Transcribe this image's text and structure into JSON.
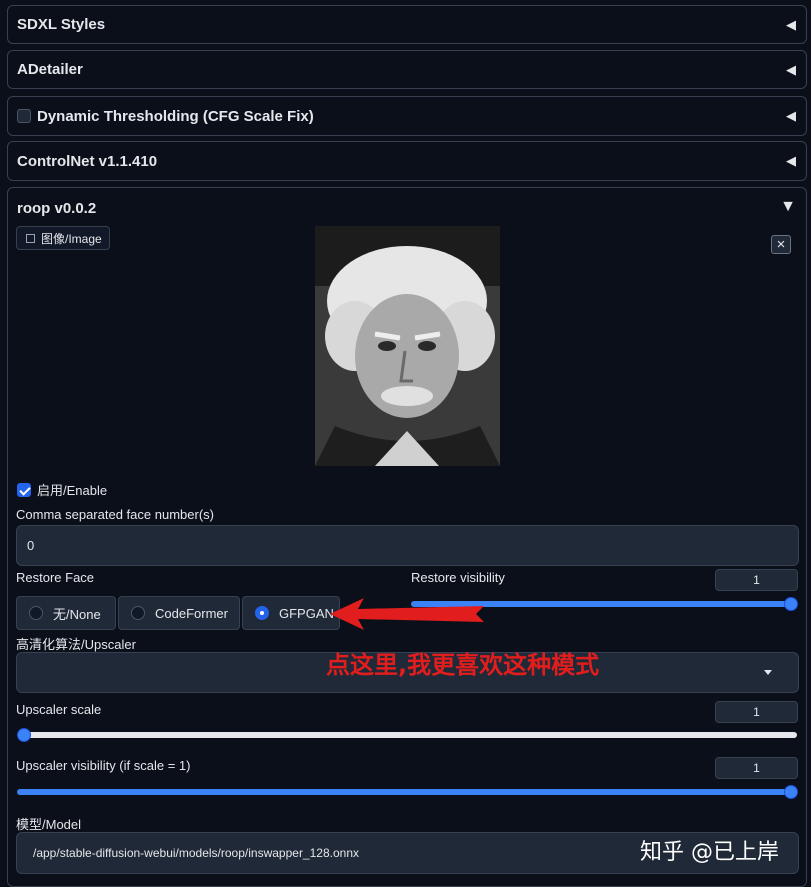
{
  "accordions": {
    "sdxl_styles": "SDXL Styles",
    "adetailer": "ADetailer",
    "dynamic_thresholding": "Dynamic Thresholding (CFG Scale Fix)",
    "controlnet": "ControlNet v1.1.410",
    "roop": "roop v0.0.2"
  },
  "collapsed_icon": "◀",
  "expanded_icon": "▼",
  "image_tab": {
    "icon": "image-icon",
    "label": "图像/Image"
  },
  "close_symbol": "×",
  "enable": {
    "label": "启用/Enable",
    "checked": true
  },
  "face_numbers": {
    "label": "Comma separated face number(s)",
    "value": "0"
  },
  "restore_face": {
    "label": "Restore Face",
    "options": [
      "无/None",
      "CodeFormer",
      "GFPGAN"
    ],
    "selected": "GFPGAN"
  },
  "restore_visibility": {
    "label": "Restore visibility",
    "value": "1",
    "fraction": 1.0
  },
  "upscaler": {
    "label": "高清化算法/Upscaler",
    "value": ""
  },
  "upscaler_scale": {
    "label": "Upscaler scale",
    "value": "1",
    "fraction": 0.0
  },
  "upscaler_visibility": {
    "label": "Upscaler visibility (if scale = 1)",
    "value": "1",
    "fraction": 1.0
  },
  "model": {
    "label": "模型/Model",
    "value": "/app/stable-diffusion-webui/models/roop/inswapper_128.onnx"
  },
  "annotation": {
    "text": "点这里,我更喜欢这种模式",
    "color": "#e11d1d"
  },
  "watermark": "知乎 @已上岸",
  "colors": {
    "accent": "#3b82f6",
    "background": "#0b0f19",
    "panel": "#1f2937"
  }
}
